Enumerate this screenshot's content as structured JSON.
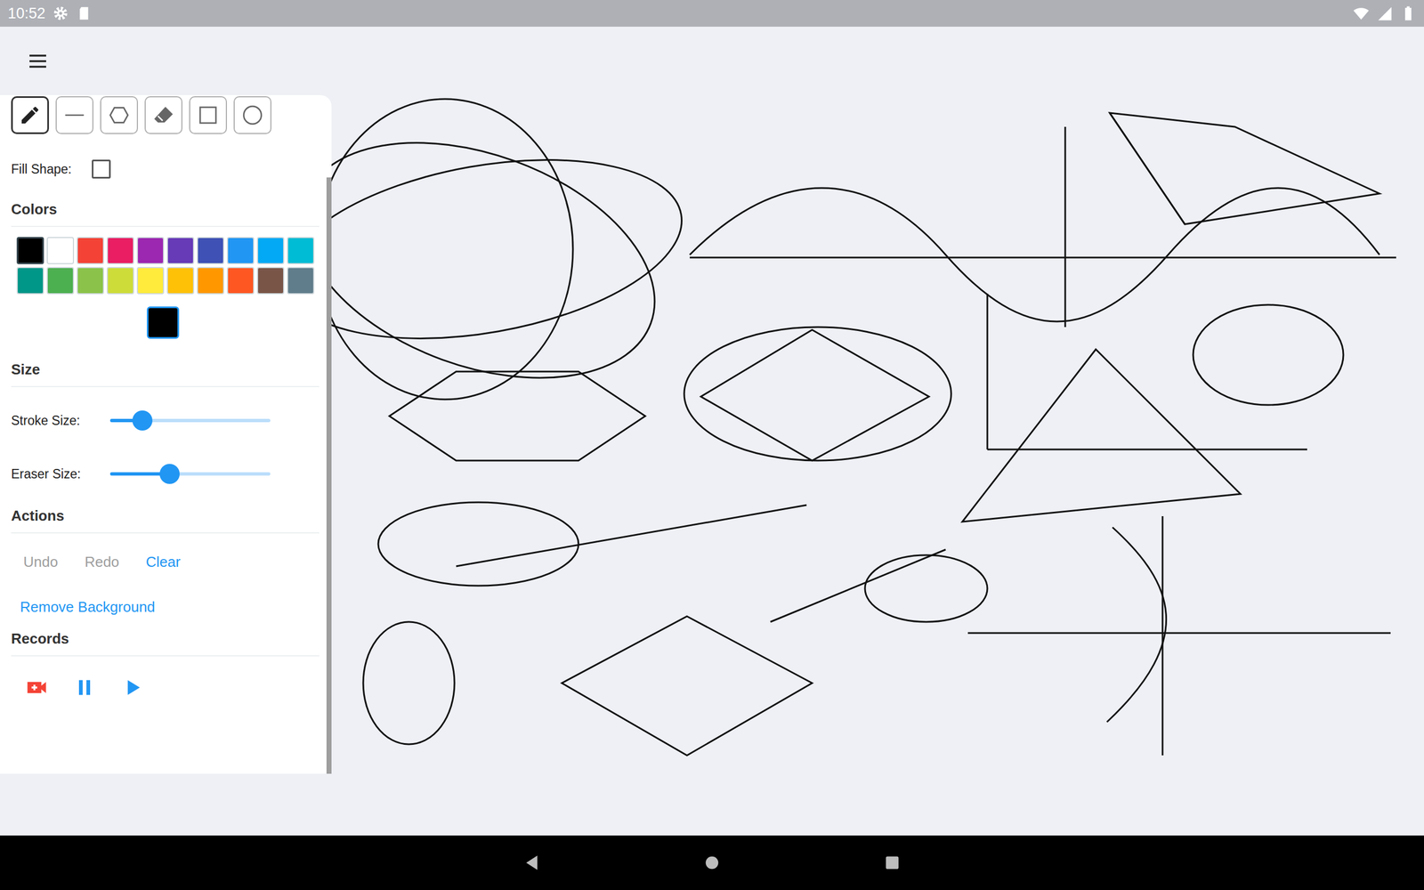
{
  "status_bar": {
    "time": "10:52"
  },
  "tools": [
    {
      "kind": "pencil",
      "selected": true
    },
    {
      "kind": "line",
      "selected": false
    },
    {
      "kind": "polygon",
      "selected": false
    },
    {
      "kind": "eraser",
      "selected": false
    },
    {
      "kind": "rectangle",
      "selected": false
    },
    {
      "kind": "circle",
      "selected": false
    }
  ],
  "fill_shape": {
    "label": "Fill Shape:",
    "checked": false
  },
  "colors": {
    "title": "Colors",
    "swatches": [
      {
        "color": "#000000",
        "selected": true
      },
      {
        "color": "#ffffff",
        "selected": false
      },
      {
        "color": "#f44336",
        "selected": false
      },
      {
        "color": "#e91e63",
        "selected": false
      },
      {
        "color": "#9c27b0",
        "selected": false
      },
      {
        "color": "#673ab7",
        "selected": false
      },
      {
        "color": "#3f51b5",
        "selected": false
      },
      {
        "color": "#2196f3",
        "selected": false
      },
      {
        "color": "#03a9f4",
        "selected": false
      },
      {
        "color": "#00bcd4",
        "selected": false
      },
      {
        "color": "#009688",
        "selected": false
      },
      {
        "color": "#4caf50",
        "selected": false
      },
      {
        "color": "#8bc34a",
        "selected": false
      },
      {
        "color": "#cddc39",
        "selected": false
      },
      {
        "color": "#ffeb3b",
        "selected": false
      },
      {
        "color": "#ffc107",
        "selected": false
      },
      {
        "color": "#ff9800",
        "selected": false
      },
      {
        "color": "#ff5722",
        "selected": false
      },
      {
        "color": "#795548",
        "selected": false
      },
      {
        "color": "#607d8b",
        "selected": false
      }
    ],
    "current": {
      "color": "#000000"
    }
  },
  "size": {
    "title": "Size",
    "sliders": [
      {
        "label": "Stroke Size:",
        "level": 0.2
      },
      {
        "label": "Eraser Size:",
        "level": 0.37
      }
    ]
  },
  "actions": {
    "title": "Actions",
    "buttons": [
      {
        "label": "Undo",
        "disabled": true
      },
      {
        "label": "Redo",
        "disabled": true
      },
      {
        "label": "Clear",
        "disabled": false
      }
    ]
  },
  "remove_background": {
    "label": "Remove Background"
  },
  "records": {
    "title": "Records",
    "buttons": [
      {
        "kind": "record"
      },
      {
        "kind": "pause"
      },
      {
        "kind": "play"
      }
    ]
  }
}
